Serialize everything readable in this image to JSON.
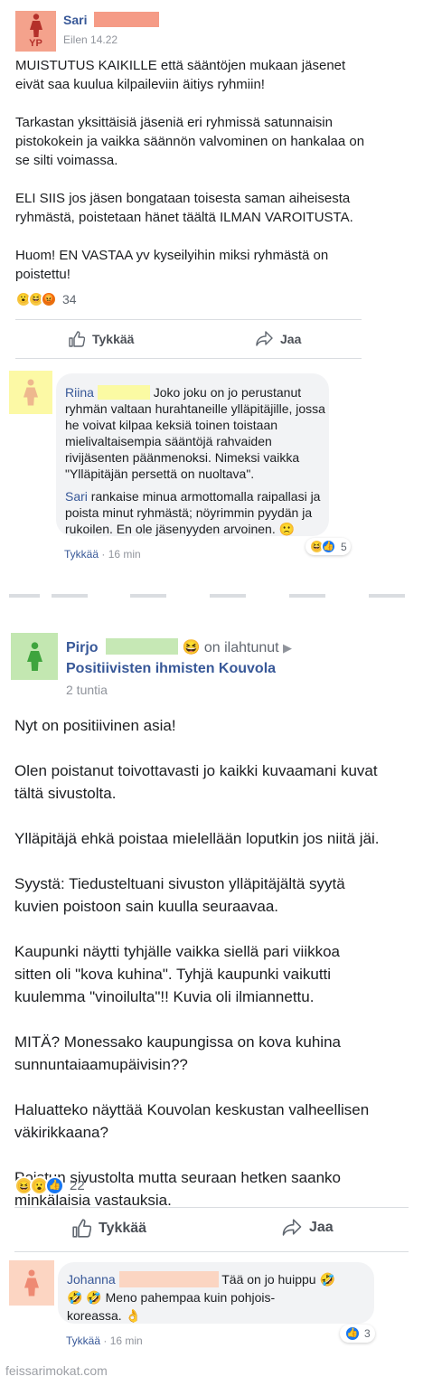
{
  "post1": {
    "avatar_initials": "YP",
    "author": "Sari",
    "time": "Eilen 14.22",
    "paragraphs": [
      "MUISTUTUS KAIKILLE että sääntöjen mukaan jäsenet eivät saa kuulua kilpaileviin äitiys ryhmiin!",
      "Tarkastan yksittäisiä jäseniä eri ryhmissä satunnaisin pistokokein ja vaikka säännön valvominen on hankalaa on se silti voimassa.",
      "ELI SIIS jos jäsen bongataan toisesta saman aiheisesta ryhmästä, poistetaan hänet täältä ILMAN VAROITUSTA.",
      "Huom! EN VASTAA yv kyseilyihin miksi ryhmästä on poistettu!"
    ],
    "reaction_count": "34",
    "like_label": "Tykkää",
    "share_label": "Jaa"
  },
  "comment1": {
    "author": "Riina",
    "text1": "Joko joku on jo perustanut ryhmän valtaan hurahtaneille ylläpitäjille, jossa he voivat kilpaa keksiä toinen toistaan mielivaltaisempia sääntöjä rahvaiden rivijäsenten päänmenoksi. Nimeksi vaikka \"Ylläpitäjän persettä on nuoltava\".",
    "mention": "Sari",
    "text2": "rankaise minua armottomalla raipallasi ja poista minut ryhmästä; nöyrimmin pyydän ja rukoilen. En ole jäsenyyden arvoinen. 🙁",
    "like_label": "Tykkää",
    "time": "16 min",
    "reaction_count": "5"
  },
  "post2": {
    "author": "Pirjo",
    "feeling": "on ilahtunut",
    "group": "Positiivisten ihmisten Kouvola",
    "time": "2 tuntia",
    "paragraphs": [
      "Nyt on positiivinen asia!",
      "Olen poistanut toivottavasti jo kaikki kuvaamani kuvat tältä sivustolta.",
      "Ylläpitäjä ehkä poistaa mielellään loputkin jos niitä jäi.",
      "Syystä: Tiedusteltuani sivuston ylläpitäjältä syytä kuvien poistoon sain kuulla seuraavaa.",
      "Kaupunki näytti tyhjälle vaikka siellä pari viikkoa sitten oli \"kova kuhina\". Tyhjä kaupunki vaikutti kuulemma \"vinoilulta\"!! Kuvia oli ilmiannettu.",
      "MITÄ? Monessako kaupungissa on kova kuhina sunnuntaiaamupäivisin??",
      "Haluatteko näyttää Kouvolan keskustan valheellisen väkirikkaana?",
      "Poistun sivustolta mutta seuraan hetken saanko minkälaisia vastauksia."
    ],
    "reaction_count": "22",
    "like_label": "Tykkää",
    "share_label": "Jaa"
  },
  "comment2": {
    "author": "Johanna",
    "text1": "Tää on jo huippu 🤣",
    "text2": "🤣 🤣 Meno pahempaa kuin pohjois-koreassa. 👌",
    "like_label": "Tykkää",
    "time": "16 min",
    "reaction_count": "3"
  },
  "footer": {
    "watermark": "feissarimokat.com"
  },
  "colors": {
    "link": "#385898",
    "redact_red": "#f59b86",
    "redact_yellow": "#fbfaa3",
    "redact_green": "#c6e8b5",
    "redact_pink": "#fbd5c2"
  }
}
